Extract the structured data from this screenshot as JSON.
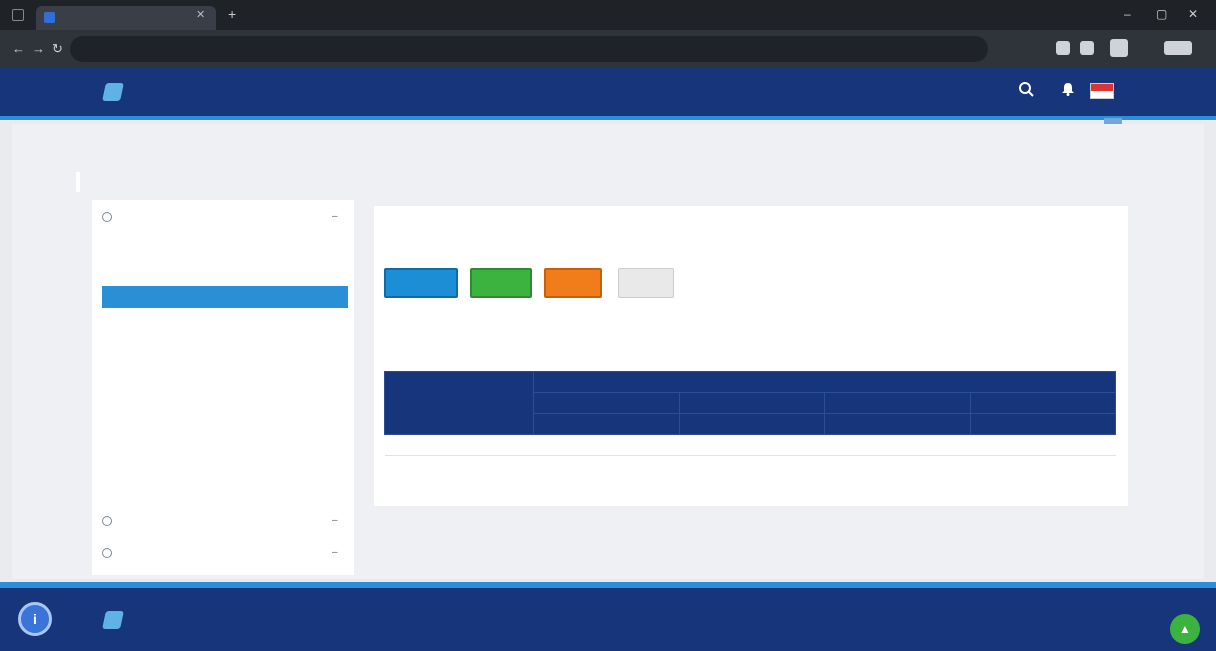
{
  "browser": {
    "tab_title": "",
    "url": "",
    "tab_close": "✕",
    "tab_new": "+",
    "win_min": "–",
    "win_max": "▢",
    "win_close": "✕",
    "nav_back": "←",
    "nav_fwd": "→",
    "nav_reload": "↻"
  },
  "header": {
    "brand": "",
    "nav": [
      "",
      "",
      "",
      "",
      ""
    ]
  },
  "breadcrumb": {
    "items": [
      "",
      "",
      ""
    ],
    "current": ""
  },
  "page": {
    "title": ""
  },
  "sidebar": {
    "section_top": "",
    "items": [
      {
        "label": "",
        "active": false
      },
      {
        "label": "",
        "active": false
      },
      {
        "label": "",
        "active": true
      },
      {
        "label": "",
        "active": false
      },
      {
        "label": "",
        "active": false
      },
      {
        "label": "",
        "active": false
      },
      {
        "label": "",
        "active": false
      },
      {
        "label": "",
        "active": false
      },
      {
        "label": "",
        "active": false
      },
      {
        "label": "",
        "active": false
      },
      {
        "label": "",
        "active": false
      }
    ],
    "section_bottom_1": "",
    "section_bottom_2": "",
    "chevron_glyph": "–"
  },
  "main": {
    "title": "",
    "subtitle": "",
    "buttons": {
      "blue": "",
      "green": "",
      "orange": "",
      "gray": ""
    },
    "label_left": "",
    "label_right": "",
    "link": "",
    "table": {
      "top_header": "",
      "row_header": "",
      "col_years": [
        "",
        "",
        "",
        ""
      ],
      "col_sub": [
        "",
        "",
        "",
        ""
      ],
      "rows": [
        {
          "label": "",
          "values": [
            "",
            "",
            "",
            ""
          ]
        }
      ]
    },
    "notes": [
      "",
      ""
    ]
  },
  "footer": {
    "brand": "",
    "help_glyph": "i",
    "up_glyph": "▲"
  },
  "colors": {
    "header_bg": "#16357a",
    "accent": "#2a8fd4",
    "btn_blue": "#1b8ed6",
    "btn_green": "#3db33f",
    "btn_orange": "#f07d1a"
  },
  "icons": [
    "tab-favicon-icon",
    "back-arrow-icon",
    "forward-arrow-icon",
    "reload-icon",
    "brand-logo-icon",
    "search-icon",
    "bell-icon",
    "language-flag-icon",
    "section-circle-icon",
    "help-icon",
    "scroll-up-icon"
  ]
}
